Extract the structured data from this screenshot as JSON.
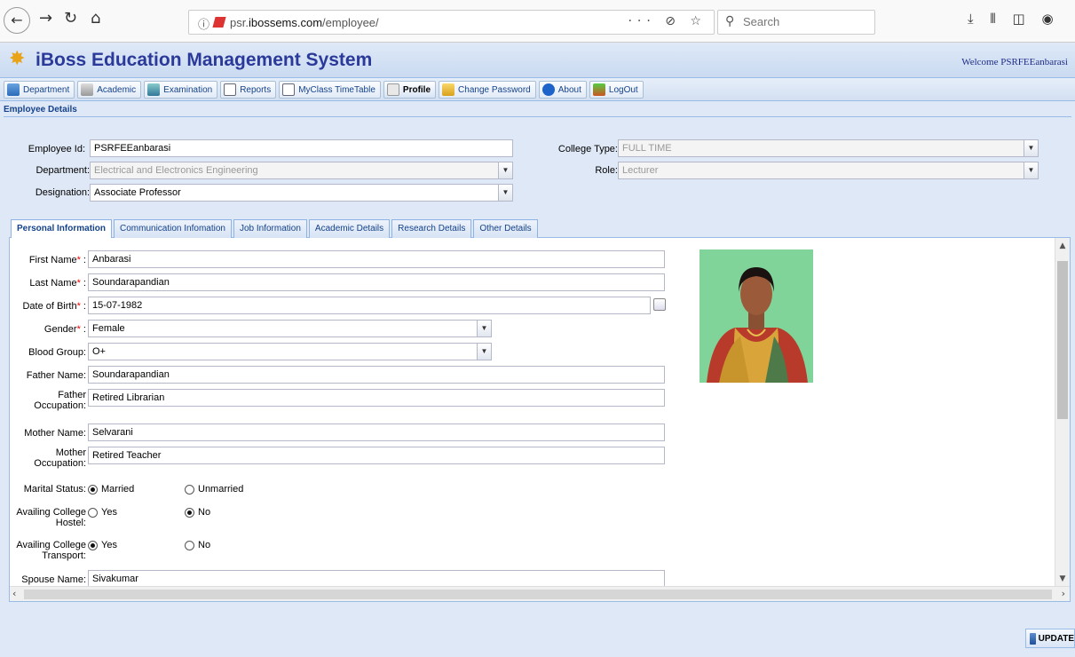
{
  "browser": {
    "info_icon": "info-icon",
    "url_prefix": "psr.",
    "url_domain": "ibossems.com",
    "url_path": "/employee/",
    "page_actions": "··· ⊘ ☆",
    "search_placeholder": "Search",
    "tools": [
      "download-icon",
      "library-icon",
      "sidebar-icon",
      "extension-icon"
    ]
  },
  "app": {
    "title": "iBoss Education Management System",
    "welcome": "Welcome PSRFEEanbarasi"
  },
  "menu": [
    {
      "label": "Department",
      "icon": "department-icon"
    },
    {
      "label": "Academic",
      "icon": "academic-icon"
    },
    {
      "label": "Examination",
      "icon": "examination-icon"
    },
    {
      "label": "Reports",
      "icon": "reports-icon"
    },
    {
      "label": "MyClass TimeTable",
      "icon": "timetable-icon"
    },
    {
      "label": "Profile",
      "icon": "profile-icon",
      "active": true
    },
    {
      "label": "Change Password",
      "icon": "lock-icon"
    },
    {
      "label": "About",
      "icon": "info-icon"
    },
    {
      "label": "LogOut",
      "icon": "logout-icon"
    }
  ],
  "employee": {
    "section_title": "Employee Details",
    "id_label": "Employee Id:",
    "id_value": "PSRFEEanbarasi",
    "department_label": "Department:",
    "department_value": "Electrical and Electronics Engineering",
    "designation_label": "Designation:",
    "designation_value": "Associate Professor",
    "college_type_label": "College Type:",
    "college_type_value": "FULL TIME",
    "role_label": "Role:",
    "role_value": "Lecturer"
  },
  "tabs": [
    {
      "label": "Personal Information",
      "active": true
    },
    {
      "label": "Communication Infomation"
    },
    {
      "label": "Job Information"
    },
    {
      "label": "Academic Details"
    },
    {
      "label": "Research Details"
    },
    {
      "label": "Other Details"
    }
  ],
  "personal": {
    "first_name_label": "First Name",
    "first_name": "Anbarasi",
    "last_name_label": "Last Name",
    "last_name": "Soundarapandian",
    "dob_label": "Date of Birth",
    "dob": "15-07-1982",
    "gender_label": "Gender",
    "gender": "Female",
    "blood_group_label": "Blood Group:",
    "blood_group": "O+",
    "father_name_label": "Father Name:",
    "father_name": "Soundarapandian",
    "father_occ_label_1": "Father",
    "father_occ_label_2": "Occupation:",
    "father_occ": "Retired Librarian",
    "mother_name_label": "Mother Name:",
    "mother_name": "Selvarani",
    "mother_occ_label_1": "Mother",
    "mother_occ_label_2": "Occupation:",
    "mother_occ": "Retired Teacher",
    "marital_label": "Marital Status:",
    "married": "Married",
    "unmarried": "Unmarried",
    "hostel_label_1": "Availing College",
    "hostel_label_2": "Hostel:",
    "transport_label_1": "Availing College",
    "transport_label_2": "Transport:",
    "yes": "Yes",
    "no": "No",
    "spouse_label": "Spouse Name:",
    "spouse": "Sivakumar",
    "req_suffix": " :",
    "req_mark": "*"
  },
  "actions": {
    "update": "UPDATE"
  },
  "colors": {
    "header_title": "#2b3a9a",
    "tab_text": "#15428b",
    "required": "#ee0000"
  }
}
